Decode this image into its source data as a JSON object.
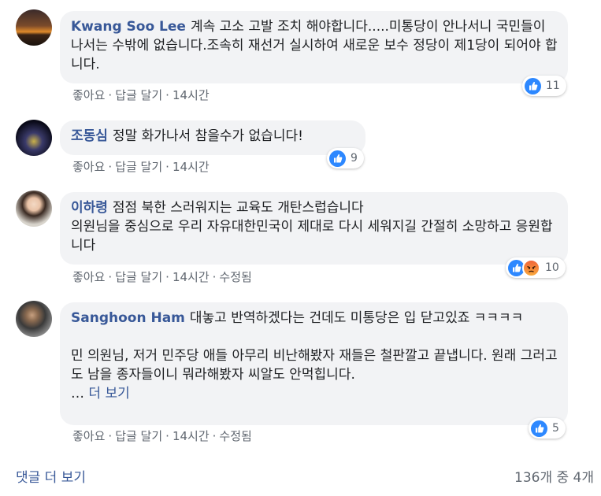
{
  "comments": [
    {
      "author": "Kwang Soo Lee",
      "text": "계속 고소 고발 조치 해야합니다.....미통당이 안나서니 국민들이 나서는 수밖에 없습니다.조속히 재선거 실시하여 새로운 보수 정당이 제1당이 되어야 합니다.",
      "actions": {
        "like": "좋아요",
        "reply": "답글 달기",
        "time": "14시간"
      },
      "reactions": {
        "icons": [
          "like-icon"
        ],
        "count": "11"
      }
    },
    {
      "author": "조동심",
      "text": "정말 화가나서 참을수가 없습니다!",
      "actions": {
        "like": "좋아요",
        "reply": "답글 달기",
        "time": "14시간"
      },
      "reactions": {
        "icons": [
          "like-icon"
        ],
        "count": "9"
      }
    },
    {
      "author": "이하령",
      "text": "점점 북한 스러워지는 교육도 개탄스럽습니다\n의원님을 중심으로 우리 자유대한민국이 제대로 다시 세워지길 간절히 소망하고 응원합니다",
      "actions": {
        "like": "좋아요",
        "reply": "답글 달기",
        "time": "14시간",
        "edited": "수정됨"
      },
      "reactions": {
        "icons": [
          "like-icon",
          "angry-icon"
        ],
        "count": "10"
      }
    },
    {
      "author": "Sanghoon Ham",
      "text": "대놓고 반역하겠다는 건데도 미통당은 입 닫고있죠 ㅋㅋㅋㅋ\n\n민 의원님, 저거 민주당 애들 아무리 비난해봤자 재들은 철판깔고 끝냅니다. 원래 그러고도 남을 종자들이니 뭐라해봤자 씨알도 안먹힙니다.",
      "ellipsis": "…",
      "see_more": "더 보기",
      "actions": {
        "like": "좋아요",
        "reply": "답글 달기",
        "time": "14시간",
        "edited": "수정됨"
      },
      "reactions": {
        "icons": [
          "like-icon"
        ],
        "count": "5"
      }
    }
  ],
  "footer": {
    "view_more": "댓글 더 보기",
    "count": "136개 중 4개"
  },
  "colors": {
    "author": "#385898",
    "bubble": "#f2f3f5",
    "meta": "#606770",
    "like": "#2d88ff"
  }
}
